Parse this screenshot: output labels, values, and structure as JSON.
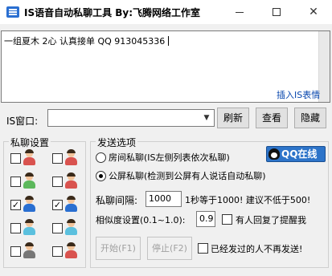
{
  "window": {
    "title": "IS语音自动私聊工具  By:飞腾网络工作室",
    "minimize_icon": "minimize-icon",
    "maximize_icon": "maximize-icon",
    "close_icon": "close-icon"
  },
  "message": {
    "text": "一组夏木  2心  认真接单 QQ 913045336",
    "insert_link": "插入IS表情"
  },
  "is_window": {
    "label": "IS窗口:",
    "selected_value": "",
    "refresh_label": "刷新",
    "view_label": "查看",
    "hide_label": "隐藏"
  },
  "chat_settings": {
    "legend": "私聊设置",
    "accounts": [
      {
        "checked": false,
        "color": "#d9534f"
      },
      {
        "checked": false,
        "color": "#d9534f"
      },
      {
        "checked": false,
        "color": "#5cb85c"
      },
      {
        "checked": false,
        "color": "#d9534f"
      },
      {
        "checked": true,
        "color": "#2a6fd1"
      },
      {
        "checked": true,
        "color": "#2a6fd1"
      },
      {
        "checked": false,
        "color": "#5bc0de"
      },
      {
        "checked": false,
        "color": "#5bc0de"
      },
      {
        "checked": false,
        "color": "#777777"
      },
      {
        "checked": false,
        "color": "#d9534f"
      }
    ]
  },
  "send_options": {
    "legend": "发送选项",
    "room_private_label": "房间私聊(IS左侧列表依次私聊)",
    "room_private_selected": false,
    "public_private_label": "公屏私聊(检测到公屏有人说话自动私聊)",
    "public_private_selected": true,
    "qq_online_label": "QQ在线",
    "interval_label": "私聊间隔:",
    "interval_value": "1000",
    "interval_hint": "1秒等于1000! 建议不低于500!",
    "similarity_label": "相似度设置(0.1~1.0):",
    "similarity_value": "0.9",
    "remind_reply_label": "有人回复了提醒我",
    "remind_reply_checked": false,
    "start_label": "开始(F1)",
    "stop_label": "停止(F2)",
    "no_repeat_label": "已经发过的人不再发送!",
    "no_repeat_checked": false
  }
}
